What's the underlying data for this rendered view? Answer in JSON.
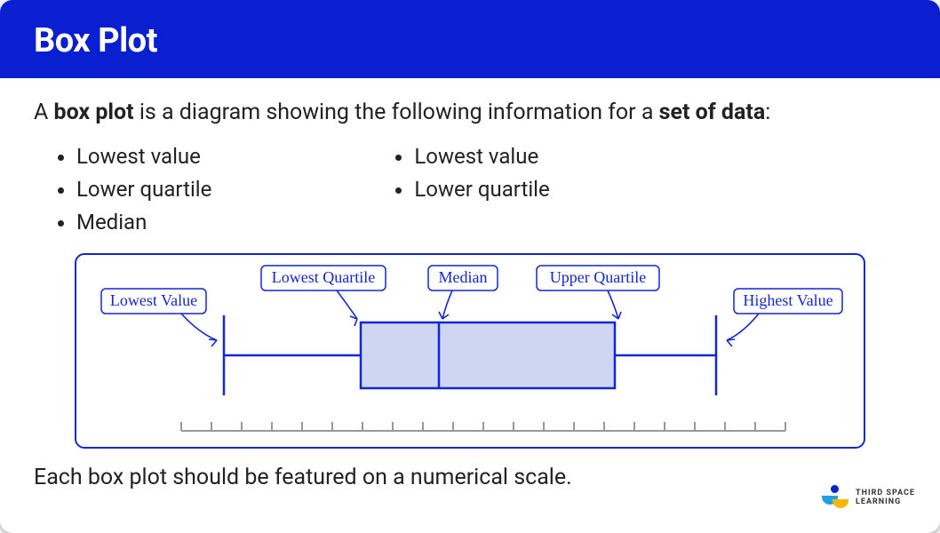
{
  "header": {
    "title": "Box Plot"
  },
  "intro": {
    "prefix": "A ",
    "bold1": "box plot",
    "mid": " is a diagram showing the following information for a ",
    "bold2": "set of data",
    "suffix": ":"
  },
  "list_left": [
    "Lowest value",
    "Lower quartile",
    "Median"
  ],
  "list_right": [
    "Lowest value",
    "Lower quartile"
  ],
  "diagram": {
    "labels": {
      "lowest_value": "Lowest Value",
      "lowest_quartile": "Lowest Quartile",
      "median": "Median",
      "upper_quartile": "Upper Quartile",
      "highest_value": "Highest Value"
    },
    "colors": {
      "stroke": "#1326d6",
      "box_fill": "#cfd6f2",
      "scale": "#999999"
    }
  },
  "footer": "Each box plot should be featured on a numerical scale.",
  "logo": {
    "line1": "THIRD SPACE",
    "line2": "LEARNING"
  },
  "chart_data": {
    "type": "boxplot",
    "title": "Box Plot",
    "components": [
      "Lowest Value",
      "Lowest Quartile",
      "Median",
      "Upper Quartile",
      "Highest Value"
    ],
    "positions_relative": {
      "lowest": 0.11,
      "q1": 0.33,
      "median": 0.44,
      "q3": 0.66,
      "highest": 0.83
    },
    "scale_ticks": 21,
    "xlabel": "",
    "ylabel": ""
  }
}
